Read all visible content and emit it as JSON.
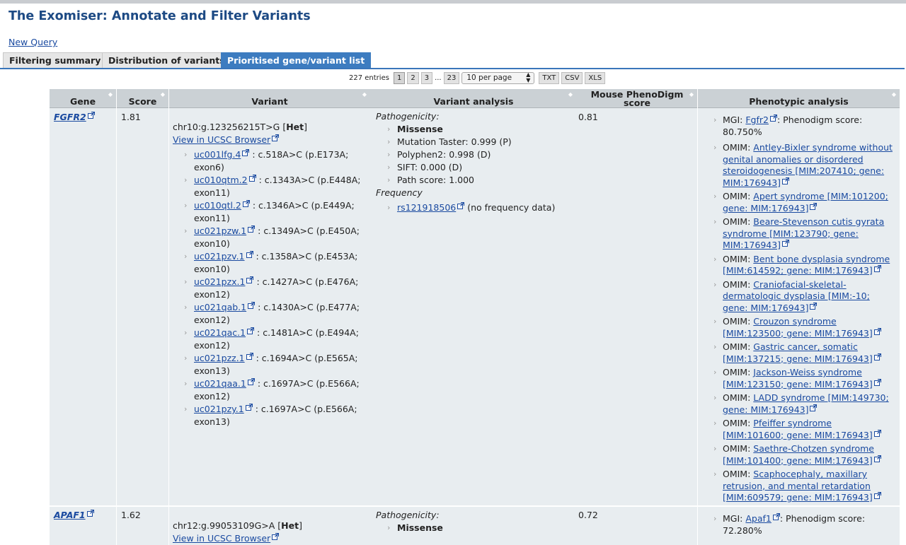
{
  "app": {
    "title": "The Exomiser: Annotate and Filter Variants"
  },
  "nav": {
    "new_query": "New Query"
  },
  "tabs": [
    {
      "label": "Filtering summary"
    },
    {
      "label": "Distribution of variants"
    },
    {
      "label": "Prioritised gene/variant list"
    }
  ],
  "pager": {
    "entries": "227 entries",
    "pages": [
      "1",
      "2",
      "3"
    ],
    "ellipsis": "...",
    "last_page": "23",
    "per_page": "10 per page",
    "exports": [
      "TXT",
      "CSV",
      "XLS"
    ]
  },
  "table": {
    "headers": {
      "gene": "Gene",
      "score": "Score",
      "variant": "Variant",
      "variant_analysis": "Variant analysis",
      "mouse_line1": "Mouse PhenoDigm",
      "mouse_line2": "score",
      "phenotypic": "Phenotypic analysis"
    },
    "rows": [
      {
        "gene": "FGFR2",
        "score": "1.81",
        "variant": {
          "coord": "chr10:g.123256215T>G",
          "zygosity": "Het",
          "ucsc": "View in UCSC Browser",
          "transcripts": [
            {
              "id": "uc001lfg.4",
              "change": ": c.518A>C (p.E173A;",
              "exon": "exon6)"
            },
            {
              "id": "uc010qtm.2",
              "change": ": c.1343A>C (p.E448A;",
              "exon": "exon11)"
            },
            {
              "id": "uc010qtl.2",
              "change": ": c.1346A>C (p.E449A;",
              "exon": "exon11)"
            },
            {
              "id": "uc021pzw.1",
              "change": ": c.1349A>C (p.E450A;",
              "exon": "exon10)"
            },
            {
              "id": "uc021pzv.1",
              "change": ": c.1358A>C (p.E453A;",
              "exon": "exon10)"
            },
            {
              "id": "uc021pzx.1",
              "change": ": c.1427A>C (p.E476A;",
              "exon": "exon12)"
            },
            {
              "id": "uc021qab.1",
              "change": ": c.1430A>C (p.E477A;",
              "exon": "exon12)"
            },
            {
              "id": "uc021qac.1",
              "change": ": c.1481A>C (p.E494A;",
              "exon": "exon12)"
            },
            {
              "id": "uc021pzz.1",
              "change": ": c.1694A>C (p.E565A;",
              "exon": "exon13)"
            },
            {
              "id": "uc021qaa.1",
              "change": ": c.1697A>C (p.E566A;",
              "exon": "exon12)"
            },
            {
              "id": "uc021pzy.1",
              "change": ": c.1697A>C (p.E566A;",
              "exon": "exon13)"
            }
          ]
        },
        "analysis": {
          "pathogenicity_label": "Pathogenicity:",
          "effect": "Missense",
          "scores": [
            "Mutation Taster: 0.999 (P)",
            "Polyphen2: 0.998 (D)",
            "SIFT: 0.000 (D)",
            "Path score: 1.000"
          ],
          "frequency_label": "Frequency",
          "rsid": "rs121918506",
          "freq_note": "(no frequency data)"
        },
        "mouse_score": "0.81",
        "mgi": {
          "prefix": "MGI:",
          "link": "Fgfr2",
          "suffix": ": Phenodigm score:",
          "line2": "80.750%"
        },
        "omim": [
          {
            "prefix": "OMIM:",
            "lines": [
              "Antley-Bixler syndrome without",
              "genital anomalies or disordered",
              "steroidogenesis [MIM:207410; gene:",
              "MIM:176943]"
            ]
          },
          {
            "prefix": "OMIM:",
            "lines": [
              "Apert syndrome [MIM:101200;",
              "gene: MIM:176943]"
            ]
          },
          {
            "prefix": "OMIM:",
            "lines": [
              "Beare-Stevenson cutis gyrata",
              "syndrome [MIM:123790; gene:",
              "MIM:176943]"
            ]
          },
          {
            "prefix": "OMIM:",
            "lines": [
              "Bent bone dysplasia syndrome",
              "[MIM:614592; gene: MIM:176943]"
            ]
          },
          {
            "prefix": "OMIM:",
            "lines": [
              "Craniofacial-skeletal-",
              "dermatologic dysplasia [MIM:-10;",
              "gene: MIM:176943]"
            ]
          },
          {
            "prefix": "OMIM:",
            "lines": [
              "Crouzon syndrome",
              "[MIM:123500; gene: MIM:176943]"
            ]
          },
          {
            "prefix": "OMIM:",
            "lines": [
              "Gastric cancer, somatic",
              "[MIM:137215; gene: MIM:176943]"
            ]
          },
          {
            "prefix": "OMIM:",
            "lines": [
              "Jackson-Weiss syndrome",
              "[MIM:123150; gene: MIM:176943]"
            ]
          },
          {
            "prefix": "OMIM:",
            "lines": [
              "LADD syndrome [MIM:149730;",
              "gene: MIM:176943]"
            ]
          },
          {
            "prefix": "OMIM:",
            "lines": [
              "Pfeiffer syndrome",
              "[MIM:101600; gene: MIM:176943]"
            ]
          },
          {
            "prefix": "OMIM:",
            "lines": [
              "Saethre-Chotzen syndrome",
              "[MIM:101400; gene: MIM:176943]"
            ]
          },
          {
            "prefix": "OMIM:",
            "lines": [
              "Scaphocephaly, maxillary",
              "retrusion, and mental retardation",
              "[MIM:609579; gene: MIM:176943]"
            ]
          }
        ]
      },
      {
        "gene": "APAF1",
        "score": "1.62",
        "variant": {
          "coord": "chr12:g.99053109G>A",
          "zygosity": "Het",
          "ucsc": "View in UCSC Browser"
        },
        "analysis": {
          "pathogenicity_label": "Pathogenicity:",
          "effect": "Missense"
        },
        "mouse_score": "0.72",
        "mgi": {
          "prefix": "MGI:",
          "link": "Apaf1",
          "suffix": ": Phenodigm score:",
          "line2": "72.280%"
        }
      }
    ]
  },
  "icons": {
    "external_link": "external-link-icon",
    "sort": "sort-icon",
    "bullet": "chevron-right-icon"
  }
}
